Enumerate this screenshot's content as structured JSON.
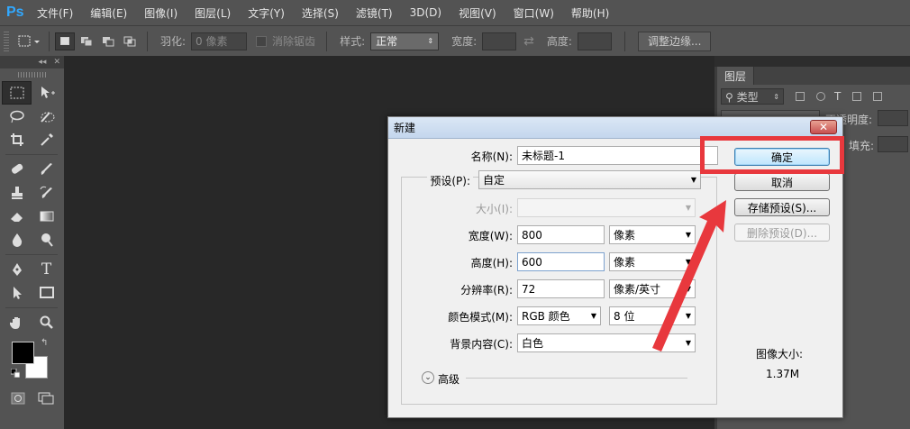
{
  "app": {
    "logo": "Ps"
  },
  "menu": [
    "文件(F)",
    "编辑(E)",
    "图像(I)",
    "图层(L)",
    "文字(Y)",
    "选择(S)",
    "滤镜(T)",
    "3D(D)",
    "视图(V)",
    "窗口(W)",
    "帮助(H)"
  ],
  "options": {
    "feather_label": "羽化:",
    "feather_value": "0 像素",
    "antialias_label": "消除锯齿",
    "style_label": "样式:",
    "style_value": "正常",
    "width_label": "宽度:",
    "height_label": "高度:",
    "refine_edge": "调整边缘..."
  },
  "layers_panel": {
    "tab": "图层",
    "kind": "类型",
    "opacity_label": "不透明度:",
    "fill_label": "填充:"
  },
  "dialog": {
    "title": "新建",
    "name_label": "名称(N):",
    "name_value": "未标题-1",
    "preset_label": "预设(P):",
    "preset_value": "自定",
    "size_label": "大小(I):",
    "width_label": "宽度(W):",
    "width_value": "800",
    "width_unit": "像素",
    "height_label": "高度(H):",
    "height_value": "600",
    "height_unit": "像素",
    "resolution_label": "分辨率(R):",
    "resolution_value": "72",
    "resolution_unit": "像素/英寸",
    "color_mode_label": "颜色模式(M):",
    "color_mode_value": "RGB 颜色",
    "bit_depth": "8 位",
    "background_label": "背景内容(C):",
    "background_value": "白色",
    "advanced": "高级",
    "ok": "确定",
    "cancel": "取消",
    "save_preset": "存储预设(S)...",
    "delete_preset": "删除预设(D)...",
    "image_size_label": "图像大小:",
    "image_size_value": "1.37M"
  },
  "colors": {
    "annotation_red": "#e8383d",
    "ps_blue": "#31a8ff"
  }
}
